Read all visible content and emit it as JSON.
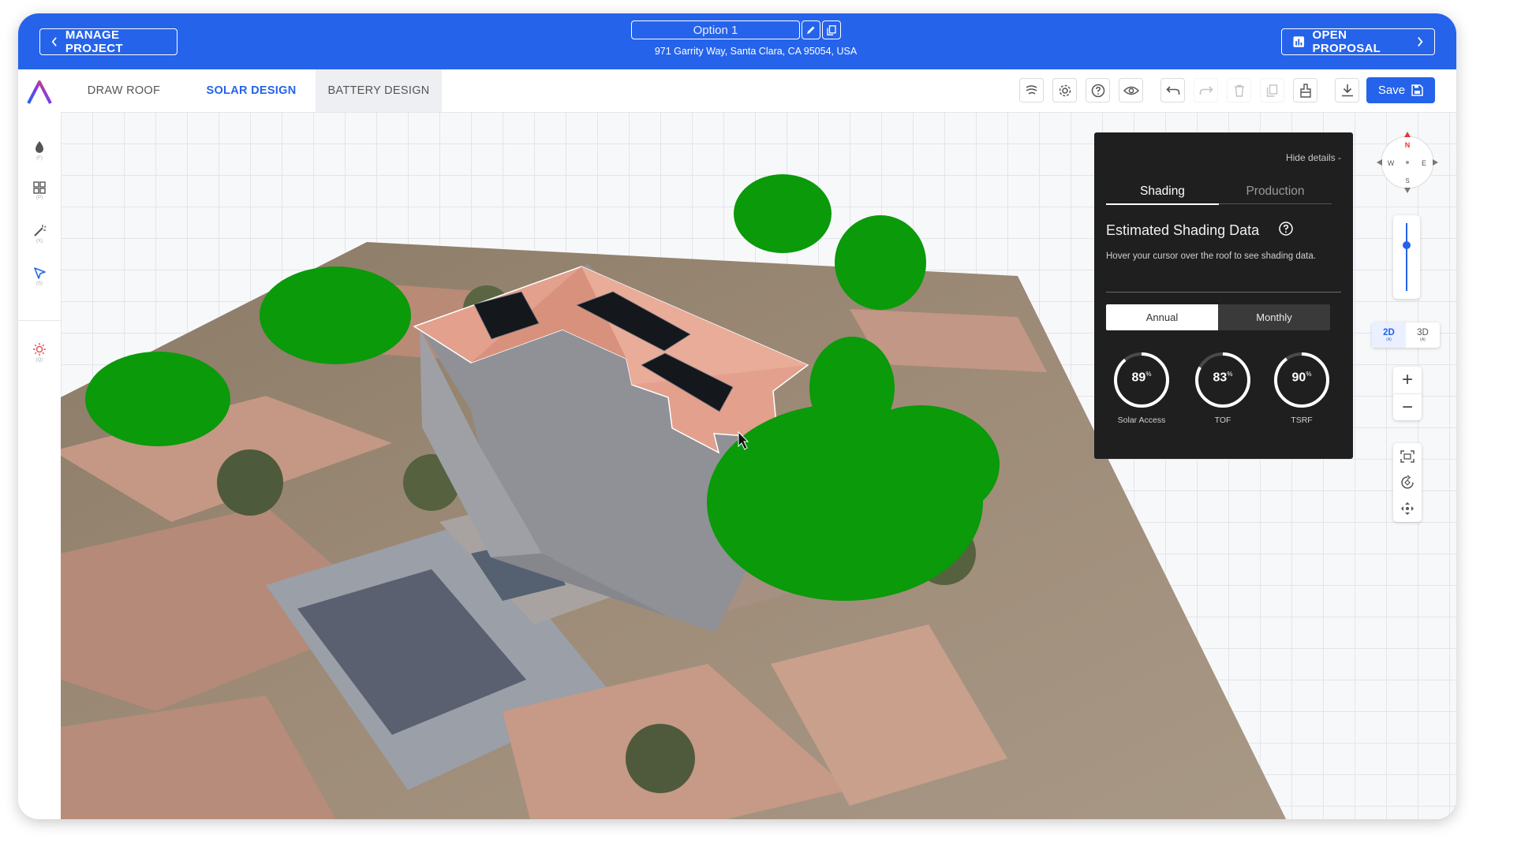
{
  "header": {
    "manage_project_label": "MANAGE PROJECT",
    "option_name": "Option 1",
    "address": "971 Garrity Way, Santa Clara, CA 95054, USA",
    "open_proposal_label": "OPEN PROPOSAL"
  },
  "tabs": [
    {
      "label": "DRAW ROOF",
      "active": false
    },
    {
      "label": "SOLAR DESIGN",
      "active": true
    },
    {
      "label": "BATTERY DESIGN",
      "active": false
    }
  ],
  "toolbar": {
    "icons": [
      "layers-icon",
      "settings-icon",
      "help-icon",
      "eye-icon",
      "undo-icon",
      "redo-icon",
      "delete-icon",
      "copy-icon",
      "paint-icon",
      "download-icon"
    ],
    "save_label": "Save"
  },
  "sidebar": {
    "items": [
      {
        "icon": "fire-icon",
        "key": "(F)"
      },
      {
        "icon": "grid-icon",
        "key": "(P)"
      },
      {
        "icon": "magic-wand-icon",
        "key": "(X)"
      },
      {
        "icon": "select-arrow-icon",
        "key": "(S)"
      },
      {
        "icon": "sun-icon",
        "key": "(Q)"
      }
    ]
  },
  "shading_panel": {
    "hide_details": "Hide details -",
    "tabs": [
      "Shading",
      "Production"
    ],
    "title": "Estimated Shading Data",
    "description": "Hover your cursor over the roof to see shading data.",
    "toggle": [
      "Annual",
      "Monthly"
    ],
    "metrics": [
      {
        "value": "89",
        "unit": "%",
        "label": "Solar Access",
        "fraction": 0.89
      },
      {
        "value": "83",
        "unit": "%",
        "label": "TOF",
        "fraction": 0.83
      },
      {
        "value": "90",
        "unit": "%",
        "label": "TSRF",
        "fraction": 0.9
      }
    ]
  },
  "compass": {
    "n": "N",
    "e": "E",
    "s": "S",
    "w": "W"
  },
  "view_controls": {
    "dim_2d": "2D",
    "dim_2d_key": "(A)",
    "dim_3d": "3D",
    "dim_3d_key": "(A)",
    "zoom_in": "+",
    "zoom_out": "−"
  },
  "colors": {
    "brand": "#2563eb",
    "panel_bg": "#1f1f1f",
    "tree": "#0a9a0a",
    "roof": "#e2a08d"
  }
}
